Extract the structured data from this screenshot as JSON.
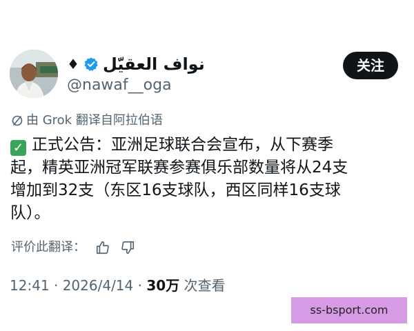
{
  "author": {
    "display_name": "نواف العقيّل",
    "flag": "♦",
    "handle": "@nawaf__oga",
    "verified_color": "#1d9bf0"
  },
  "follow_button": {
    "label": "关注"
  },
  "translation": {
    "note": "由 Grok 翻译自阿拉伯语",
    "rate_label": "评价此翻译："
  },
  "tweet": {
    "emoji": "✓",
    "lines": [
      "正式公告：亚洲足球联合会宣布，从下赛季",
      "起，精英亚洲冠军联赛参赛俱乐部数量将从24支",
      "增加到32支（东区16支球队，西区同样16支球",
      "队）。"
    ]
  },
  "meta": {
    "time": "12:41 · 2026/4/14 · ",
    "views_count": "30万",
    "views_label": " 次查看"
  },
  "watermark": {
    "text": "ss-bsport.com",
    "color": "#d79be6"
  }
}
